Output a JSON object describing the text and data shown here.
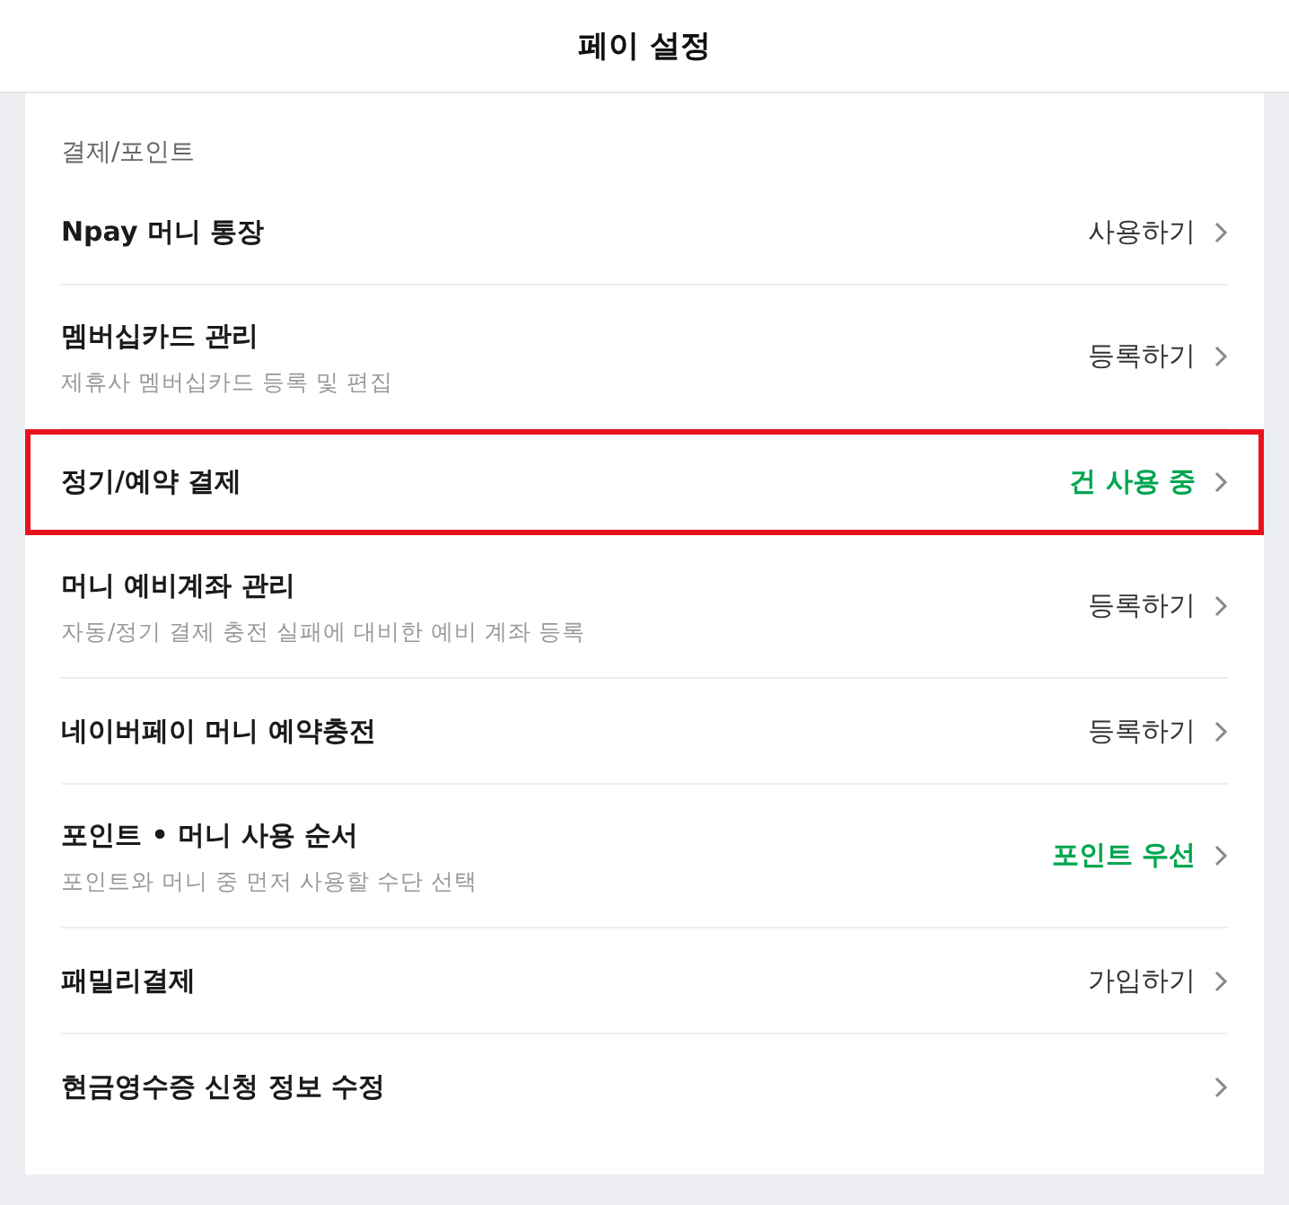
{
  "header": {
    "title": "페이 설정"
  },
  "section": {
    "label": "결제/포인트"
  },
  "rows": [
    {
      "title": "Npay 머니 통장",
      "value": "사용하기",
      "kind": "action",
      "highlighted": false
    },
    {
      "title": "멤버십카드 관리",
      "description": "제휴사 멤버십카드 등록 및 편집",
      "value": "등록하기",
      "kind": "action",
      "highlighted": false
    },
    {
      "title": "정기/예약 결제",
      "value": "건 사용 중",
      "kind": "status",
      "highlighted": true
    },
    {
      "title": "머니 예비계좌 관리",
      "description": "자동/정기 결제 충전 실패에 대비한 예비 계좌 등록",
      "value": "등록하기",
      "kind": "action",
      "highlighted": false
    },
    {
      "title": "네이버페이 머니 예약충전",
      "value": "등록하기",
      "kind": "action",
      "highlighted": false
    },
    {
      "title": "포인트 • 머니 사용 순서",
      "description": "포인트와 머니 중 먼저 사용할 수단 선택",
      "value": "포인트 우선",
      "kind": "status",
      "highlighted": false
    },
    {
      "title": "패밀리결제",
      "value": "가입하기",
      "kind": "action",
      "highlighted": false
    },
    {
      "title": "현금영수증 신청 정보 수정",
      "highlighted": false
    }
  ]
}
